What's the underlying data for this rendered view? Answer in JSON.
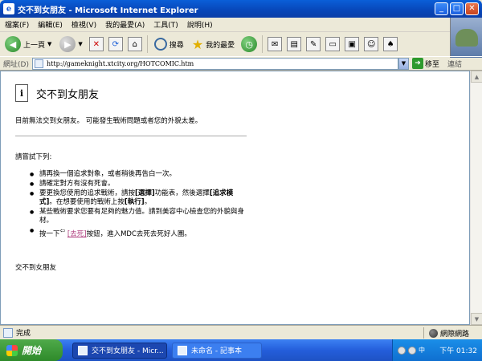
{
  "window": {
    "title": "交不到女朋友 - Microsoft Internet Explorer"
  },
  "window_controls": {
    "minimize": "_",
    "maximize": "□",
    "close": "✕"
  },
  "menu": [
    "檔案(F)",
    "編輯(E)",
    "檢視(V)",
    "我的最愛(A)",
    "工具(T)",
    "說明(H)"
  ],
  "toolbar": {
    "back_label": "上一頁",
    "search_label": "搜尋",
    "favorites_label": "我的最愛"
  },
  "address": {
    "label": "網址(D)",
    "url": "http://gameknight.xtcity.org/HOTCOMIC.htm",
    "go_label": "移至",
    "links_label": "連結"
  },
  "page": {
    "title": "交不到女朋友",
    "description": "目前無法交到女朋友。 可能發生戰術問題或者您的外貌太差。",
    "try_label": "請嘗試下列:",
    "tips": {
      "tip1": "請再換一個追求對象，或者稍後再告白一次。",
      "tip2": "請確定對方有沒有死會。",
      "tip3_pre": "要更換您使用的追求戰術，請按",
      "tip3_b1": "[選擇]",
      "tip3_mid": "功能表，然後選擇",
      "tip3_b2": "[追求模式]",
      "tip3_post": "。在想要使用的戰術上按",
      "tip3_b3": "[執行]",
      "tip3_end": "。",
      "tip4": "某些戰術要求您要有足夠的魅力值。請到美容中心檢查您的外貌與身材。",
      "tip5_pre": "按一下",
      "tip5_link": "[去死]",
      "tip5_post": "按鈕，進入MDC去死去死好人團。"
    },
    "footer": "交不到女朋友"
  },
  "status": {
    "text": "完成",
    "zone": "網際網路"
  },
  "taskbar": {
    "start": "開始",
    "task_active": "交不到女朋友 - Micr...",
    "task_inactive": "未命名 - 記事本",
    "ime": "中",
    "clock": "下午 01:32"
  }
}
